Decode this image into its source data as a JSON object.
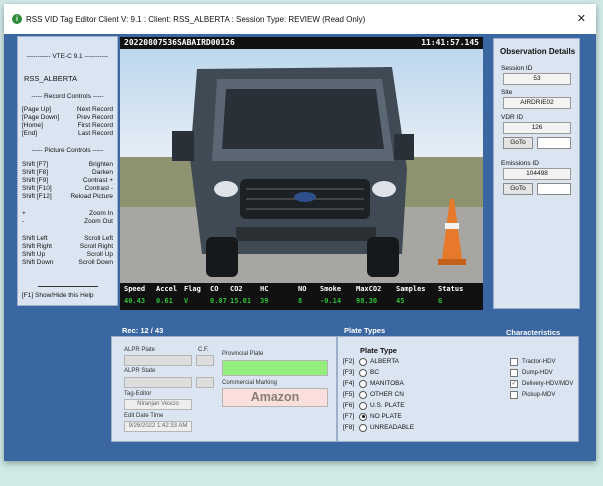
{
  "title_bar": {
    "app_title": "RSS VID Tag Editor Client V: 9.1 :  Client: RSS_ALBERTA :  Session Type: REVIEW (Read Only)",
    "close_glyph": "✕"
  },
  "help_panel": {
    "header": "----------- VTE-C 9.1 -----------",
    "org": "RSS_ALBERTA",
    "record_controls": "----- Record Controls -----",
    "record_rows": [
      [
        "[Page Up]",
        "Next Record"
      ],
      [
        "[Page Down]",
        "Prev Record"
      ],
      [
        "[Home]",
        "First Record"
      ],
      [
        "[End]",
        "Last Record"
      ]
    ],
    "picture_controls": "----- Picture Controls -----",
    "picture_rows": [
      [
        "Shift [F7]",
        "Brighten"
      ],
      [
        "Shift [F8]",
        "Darken"
      ],
      [
        "Shift [F9]",
        "Contrast +"
      ],
      [
        "Shift [F10]",
        "Contrast -"
      ],
      [
        "Shift [F12]",
        "Reload Picture"
      ]
    ],
    "zoom_rows": [
      [
        "+",
        "Zoom In"
      ],
      [
        "-",
        "Zoom Out"
      ]
    ],
    "scroll_rows": [
      [
        "Shift Left",
        "Scroll Left"
      ],
      [
        "Shift Right",
        "Scroll Right"
      ],
      [
        "Shift Up",
        "Scroll Up"
      ],
      [
        "Shift Down",
        "Scroll Down"
      ]
    ],
    "footer": "[F1] Show/Hide this Help"
  },
  "camera": {
    "plate_id": "20220807536SABAIRD00126",
    "timestamp": "11:41:57.145",
    "stat_headers": [
      "Speed",
      "Accel",
      "Flag",
      "CO",
      "CO2",
      "HC",
      "NO",
      "Smoke",
      "MaxCO2",
      "Samples",
      "Status"
    ],
    "stat_values": [
      "40.43",
      "0.61",
      "V",
      "0.07",
      "15.01",
      "39",
      "8",
      "-0.14",
      "98.30",
      "45",
      "G"
    ]
  },
  "observation": {
    "title": "Observation Details",
    "session_label": "Session ID",
    "session_value": "53",
    "site_label": "Site",
    "site_value": "AIRDRIE02",
    "vdr_label": "VDR ID",
    "vdr_value": "126",
    "emissions_label": "Emissions ID",
    "emissions_value": "104498",
    "goto_label": "GoTo"
  },
  "record": {
    "counter": "Rec: 12 / 43"
  },
  "form": {
    "alpr_plate_label": "ALPR Plate",
    "cf_label": "C.F.",
    "alpr_state_label": "ALPR State",
    "provincial_label": "Provincial Plate",
    "commercial_label": "Commercial Marking",
    "commercial_value": "Amazon",
    "tag_editor_label": "Tag-Editor",
    "tag_editor_value": "Niranjan Vescio",
    "edit_date_label": "Edit Date Time",
    "edit_date_value": "9/26/2022 1:42:33 AM"
  },
  "plate_types": {
    "section_label": "Plate Types",
    "heading": "Plate Type",
    "options": [
      {
        "key": "[F2]",
        "label": "ALBERTA",
        "selected": false
      },
      {
        "key": "[F3]",
        "label": "BC",
        "selected": false
      },
      {
        "key": "[F4]",
        "label": "MANITOBA",
        "selected": false
      },
      {
        "key": "[F5]",
        "label": "OTHER CN",
        "selected": false
      },
      {
        "key": "[F6]",
        "label": "U.S. PLATE",
        "selected": false
      },
      {
        "key": "[F7]",
        "label": "NO PLATE",
        "selected": true
      },
      {
        "key": "[F8]",
        "label": "UNREADABLE",
        "selected": false
      }
    ]
  },
  "characteristics": {
    "section_label": "Characteristics",
    "options": [
      {
        "label": "Tractor-HDV",
        "checked": false
      },
      {
        "label": "Dump-HDV",
        "checked": false
      },
      {
        "label": "Delivery-HDV/MDV",
        "checked": true
      },
      {
        "label": "Pickup-MDV",
        "checked": false
      }
    ]
  },
  "colors": {
    "window_bg": "#3a66a2",
    "panel_bg": "#dbe5f1",
    "stat_value": "#28c038",
    "provincial_fill": "#93f07c",
    "commercial_fill": "#fadfdc"
  }
}
